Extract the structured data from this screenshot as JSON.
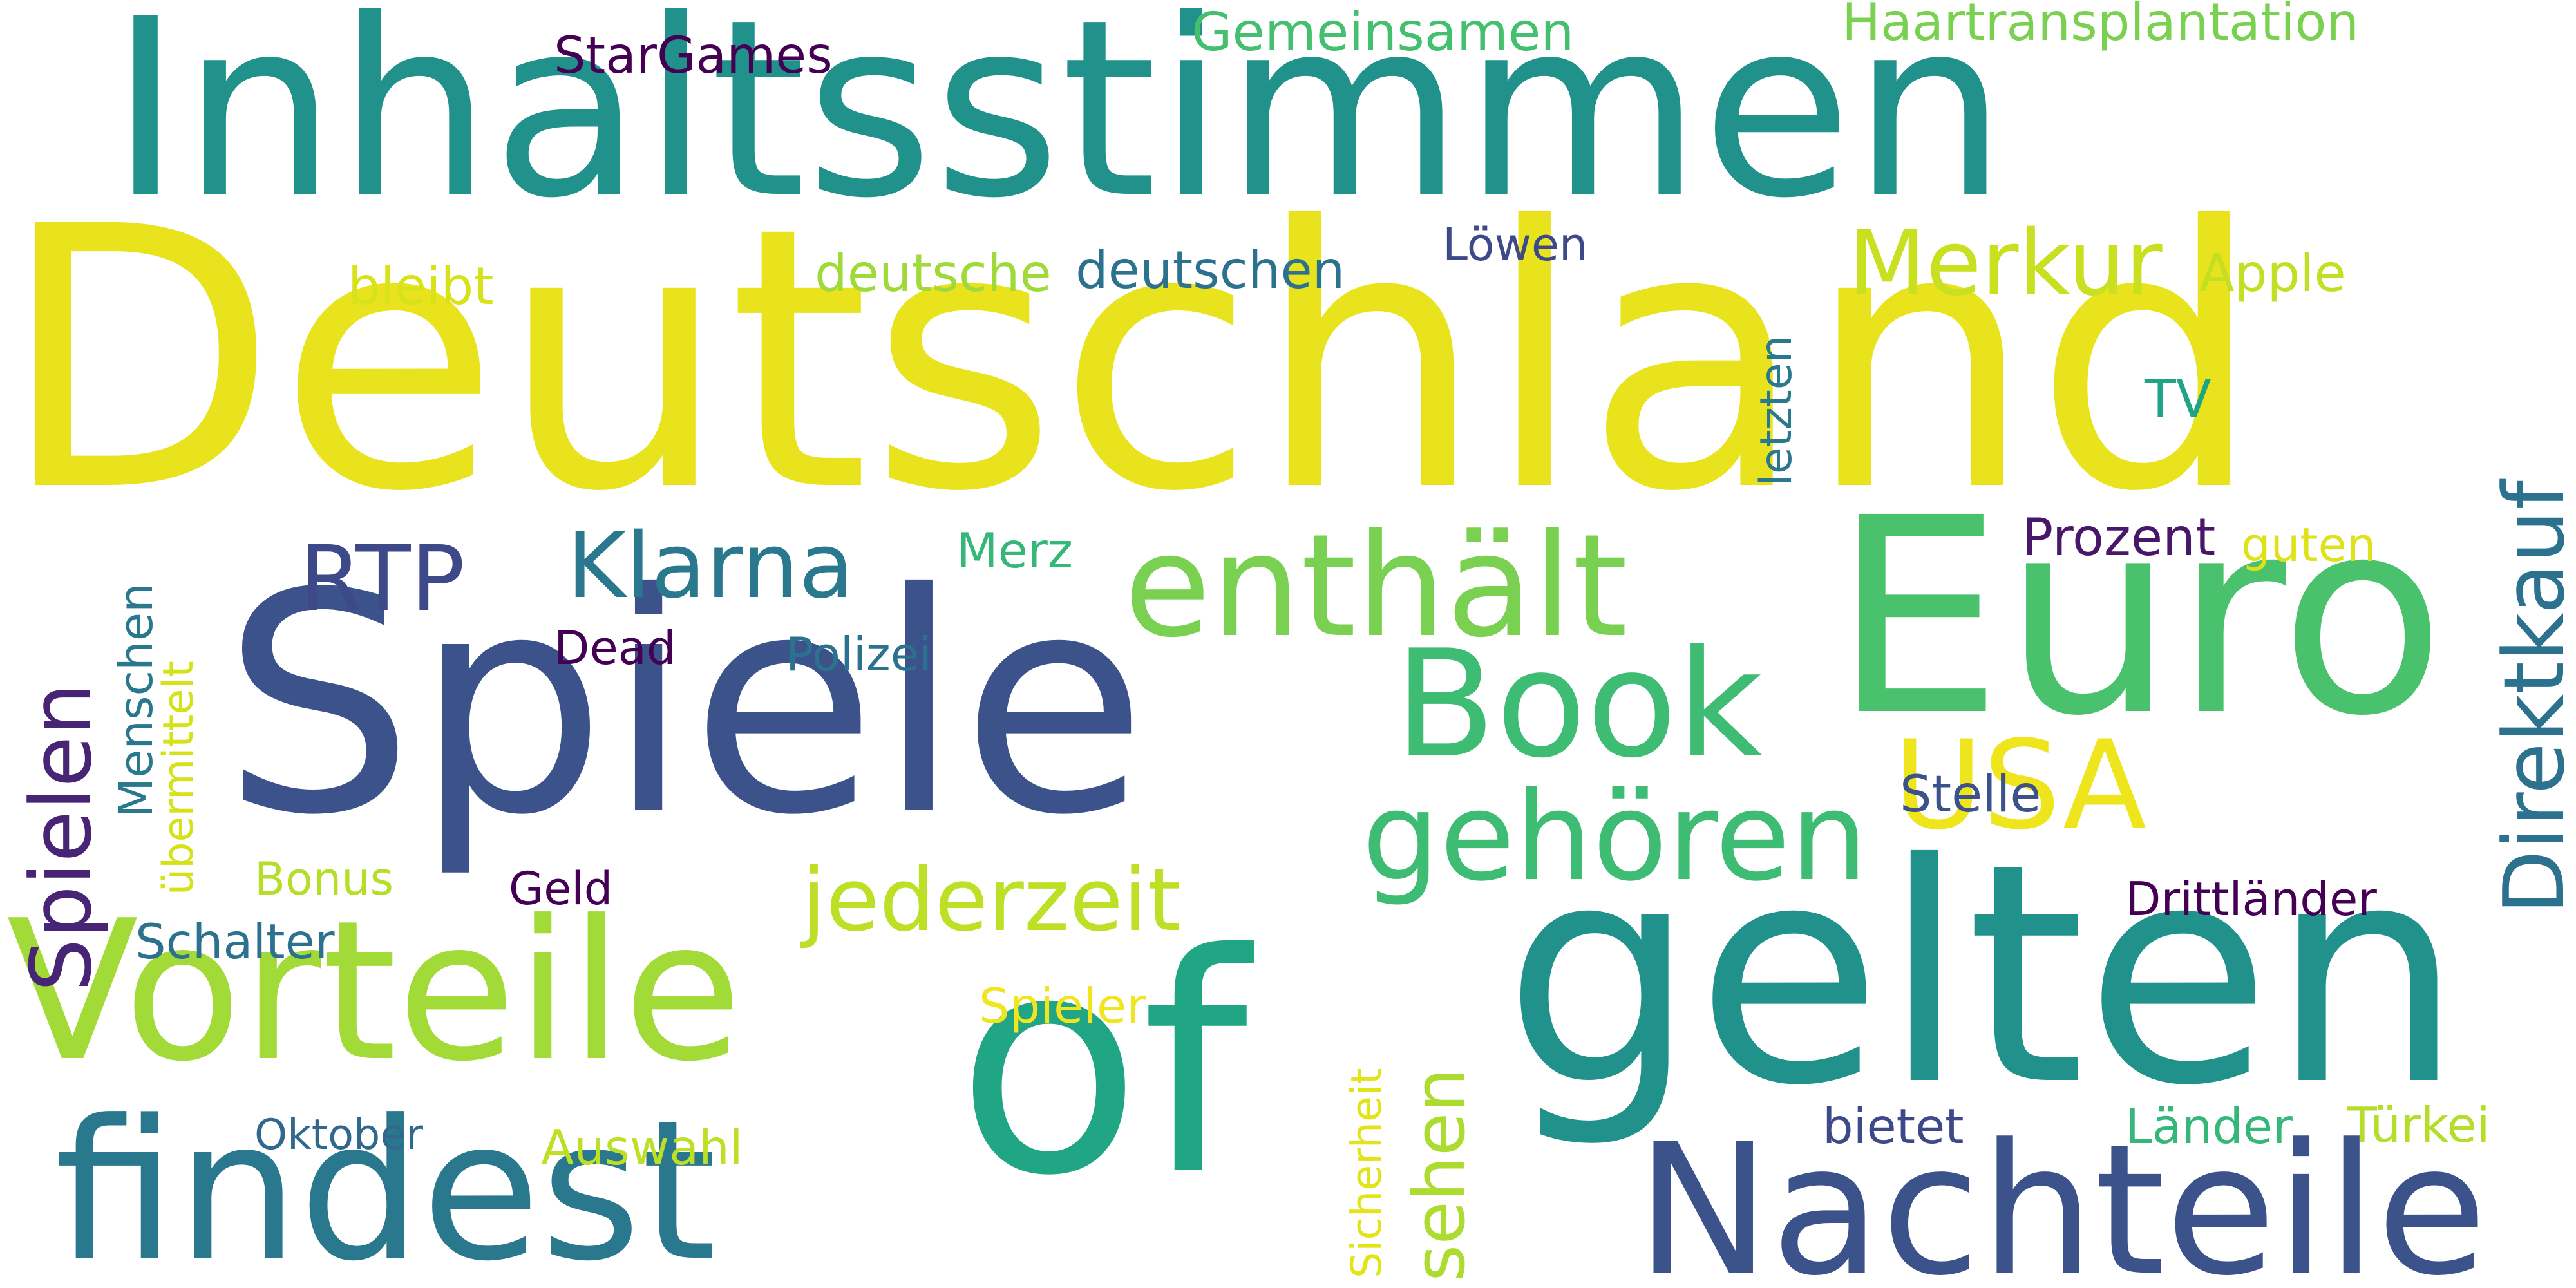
{
  "words": [
    {
      "id": "inhaltsstimmen",
      "text": "Inhaltsstimmen",
      "color": "#21918c"
    },
    {
      "id": "deutschland",
      "text": "Deutschland",
      "color": "#e8e31d"
    },
    {
      "id": "spiele",
      "text": "Spiele",
      "color": "#3b528b"
    },
    {
      "id": "euro",
      "text": "Euro",
      "color": "#4ac16d"
    },
    {
      "id": "gelten",
      "text": "gelten",
      "color": "#21918c"
    },
    {
      "id": "of",
      "text": "of",
      "color": "#21a685"
    },
    {
      "id": "vorteile",
      "text": "Vorteile",
      "color": "#a2da37"
    },
    {
      "id": "findest",
      "text": "findest",
      "color": "#2a788e"
    },
    {
      "id": "nachteile",
      "text": "Nachteile",
      "color": "#3b528b"
    },
    {
      "id": "enthaelt",
      "text": "enthält",
      "color": "#7ad151"
    },
    {
      "id": "book",
      "text": "Book",
      "color": "#3fbc73"
    },
    {
      "id": "gehoeren",
      "text": "gehören",
      "color": "#3fbc73"
    },
    {
      "id": "usa",
      "text": "USA",
      "color": "#efe51c"
    },
    {
      "id": "direktkauf",
      "text": "Direktkauf",
      "color": "#2c718e"
    },
    {
      "id": "klarna",
      "text": "Klarna",
      "color": "#2a788e"
    },
    {
      "id": "merkur",
      "text": "Merkur",
      "color": "#c8e020"
    },
    {
      "id": "rtp",
      "text": "RTP",
      "color": "#3e4989"
    },
    {
      "id": "jederzeit",
      "text": "jederzeit",
      "color": "#bddf26"
    },
    {
      "id": "spielen",
      "text": "Spielen",
      "color": "#482475"
    },
    {
      "id": "sehen",
      "text": "sehen",
      "color": "#addc30"
    },
    {
      "id": "gemeinsamen",
      "text": "Gemeinsamen",
      "color": "#44bf70"
    },
    {
      "id": "haartransplantation",
      "text": "Haartransplantation",
      "color": "#7ad151"
    },
    {
      "id": "stargames",
      "text": "StarGames",
      "color": "#440154"
    },
    {
      "id": "loewen",
      "text": "Löwen",
      "color": "#3e4989"
    },
    {
      "id": "bleibt",
      "text": "bleibt",
      "color": "#d8e219"
    },
    {
      "id": "deutsche",
      "text": "deutsche",
      "color": "#a0da39"
    },
    {
      "id": "deutschen",
      "text": "deutschen",
      "color": "#2c728e"
    },
    {
      "id": "apple",
      "text": "Apple",
      "color": "#c2df23"
    },
    {
      "id": "letzten",
      "text": "letzten",
      "color": "#2a788e"
    },
    {
      "id": "tv",
      "text": "TV",
      "color": "#20a386"
    },
    {
      "id": "prozent",
      "text": "Prozent",
      "color": "#481769"
    },
    {
      "id": "guten",
      "text": "guten",
      "color": "#dde318"
    },
    {
      "id": "merz",
      "text": "Merz",
      "color": "#35b779"
    },
    {
      "id": "menschen",
      "text": "Menschen",
      "color": "#2a788e"
    },
    {
      "id": "uebermittelt",
      "text": "übermittelt",
      "color": "#d5e21a"
    },
    {
      "id": "dead",
      "text": "Dead",
      "color": "#440154"
    },
    {
      "id": "polizei",
      "text": "Polizei",
      "color": "#2c728e"
    },
    {
      "id": "stelle",
      "text": "Stelle",
      "color": "#3b528b"
    },
    {
      "id": "bonus",
      "text": "Bonus",
      "color": "#b5de2b"
    },
    {
      "id": "geld",
      "text": "Geld",
      "color": "#440154"
    },
    {
      "id": "schalter",
      "text": "Schalter",
      "color": "#2c718e"
    },
    {
      "id": "drittlaender",
      "text": "Drittländer",
      "color": "#440154"
    },
    {
      "id": "spieler",
      "text": "Spieler",
      "color": "#f1e51d"
    },
    {
      "id": "sicherheit",
      "text": "Sicherheit",
      "color": "#e2e418"
    },
    {
      "id": "oktober",
      "text": "Oktober",
      "color": "#31688e"
    },
    {
      "id": "auswahl",
      "text": "Auswahl",
      "color": "#bddf26"
    },
    {
      "id": "bietet",
      "text": "bietet",
      "color": "#3e4989"
    },
    {
      "id": "laender",
      "text": "Länder",
      "color": "#35b779"
    },
    {
      "id": "tuerkei",
      "text": "Türkei",
      "color": "#b5de2b"
    }
  ]
}
